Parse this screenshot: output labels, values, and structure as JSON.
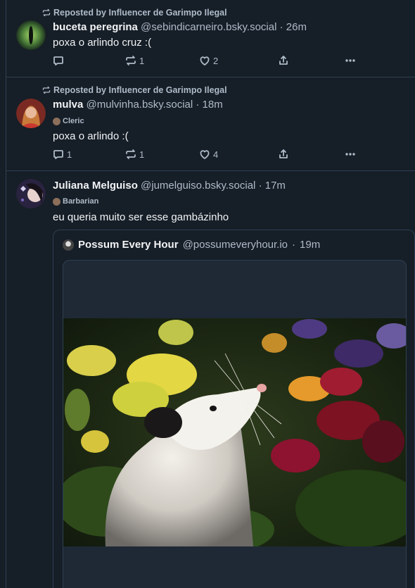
{
  "posts": [
    {
      "repost_label": "Reposted by Influencer de Garimpo Ilegal",
      "author_name": "buceta peregrina",
      "author_handle": "@sebindicarneiro.bsky.social",
      "time": "26m",
      "text": "poxa o arlindo cruz :(",
      "badge": "",
      "counts": {
        "reply": "",
        "repost": "1",
        "like": "2"
      }
    },
    {
      "repost_label": "Reposted by Influencer de Garimpo Ilegal",
      "author_name": "mulva",
      "author_handle": "@mulvinha.bsky.social",
      "time": "18m",
      "text": "poxa o arlindo :(",
      "badge": "Cleric",
      "counts": {
        "reply": "1",
        "repost": "1",
        "like": "4"
      }
    },
    {
      "repost_label": "",
      "author_name": "Juliana Melguiso",
      "author_handle": "@jumelguiso.bsky.social",
      "time": "17m",
      "text": "eu queria muito ser esse gambázinho",
      "badge": "Barbarian",
      "counts": {
        "reply": "",
        "repost": "",
        "like": ""
      }
    }
  ],
  "quote": {
    "author_name": "Possum Every Hour",
    "author_handle": "@possumeveryhour.io",
    "time": "19m"
  },
  "separator": "·",
  "colors": {
    "background": "#161e27",
    "border": "#2e4052",
    "muted": "#aebbc9",
    "text": "#f1f3f5"
  }
}
